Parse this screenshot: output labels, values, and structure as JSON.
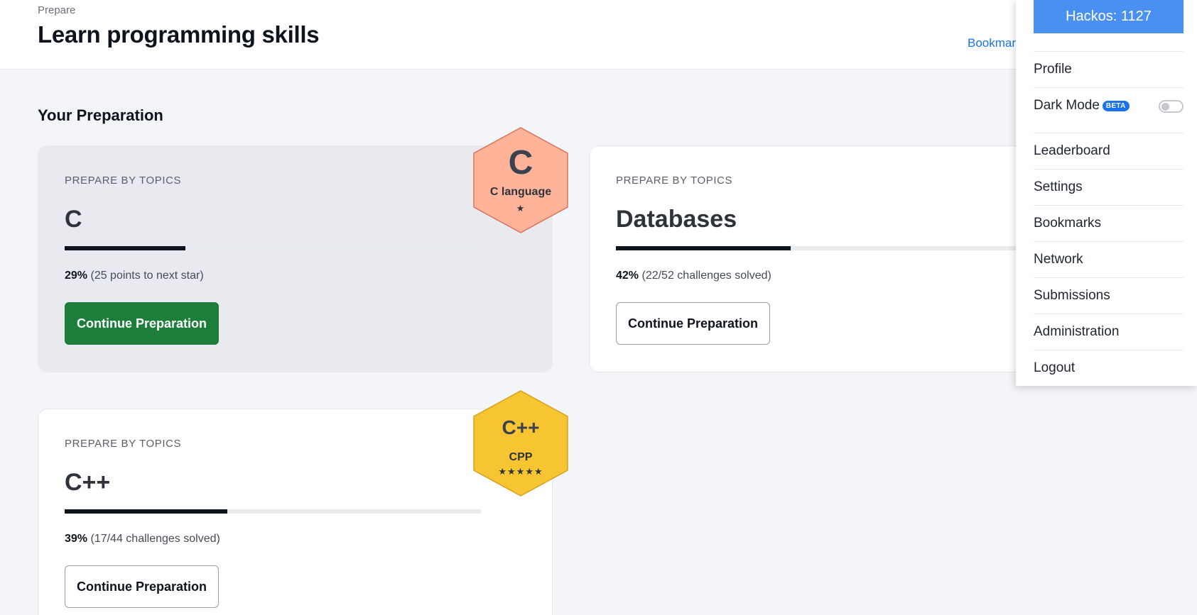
{
  "header": {
    "breadcrumb": "Prepare",
    "title": "Learn programming skills",
    "bookmark_link": "Bookmar"
  },
  "section": {
    "title": "Your Preparation"
  },
  "cards": [
    {
      "kicker": "PREPARE BY TOPICS",
      "title": "C",
      "progress_percent": 29,
      "percent_label": "29%",
      "detail": "(25 points to next star)",
      "button": "Continue Preparation",
      "badge": {
        "letter": "C",
        "name": "C language",
        "stars": "★",
        "color": "#ffb49a",
        "stroke": "#d9735c"
      }
    },
    {
      "kicker": "PREPARE BY TOPICS",
      "title": "Databases",
      "progress_percent": 42,
      "percent_label": "42%",
      "detail": "(22/52 challenges solved)",
      "button": "Continue Preparation"
    },
    {
      "kicker": "PREPARE BY TOPICS",
      "title": "C++",
      "progress_percent": 39,
      "percent_label": "39%",
      "detail": "(17/44 challenges solved)",
      "button": "Continue Preparation",
      "badge": {
        "letter": "C++",
        "name": "CPP",
        "stars": "★★★★★",
        "color": "#f7c531",
        "stroke": "#d6a21b"
      }
    }
  ],
  "menu": {
    "hackos": "Hackos: 1127",
    "items": [
      "Profile",
      "Dark Mode",
      "Leaderboard",
      "Settings",
      "Bookmarks",
      "Network",
      "Submissions",
      "Administration",
      "Logout"
    ],
    "beta_label": "BETA",
    "dark_mode_on": false
  },
  "colors": {
    "primary_button": "#1c7e3a",
    "hackos_bg": "#4a90f0",
    "link": "#1a73e8"
  }
}
